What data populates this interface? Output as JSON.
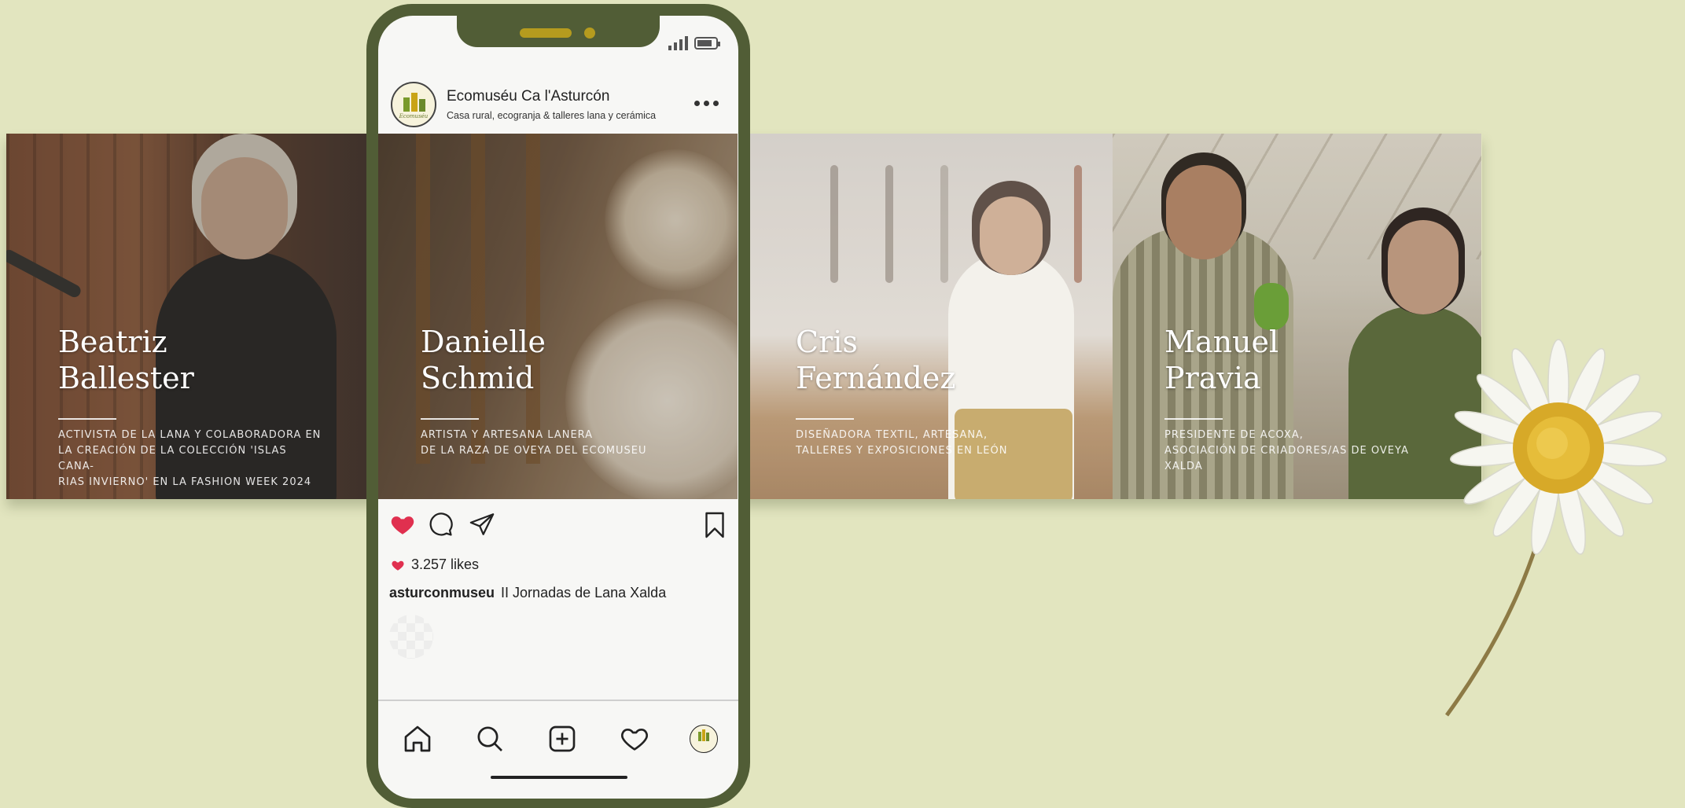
{
  "profile": {
    "name": "Ecomuséu Ca l'Asturcón",
    "subtitle": "Casa rural, ecogranja & talleres lana y cerámica",
    "logo_text": "Ecomuséu"
  },
  "post": {
    "likes": "3.257 likes",
    "caption_user": "asturconmuseu",
    "caption_text": "II Jornadas de Lana Xalda"
  },
  "panels": [
    {
      "name": "Beatriz\nBallester",
      "description": "ACTIVISTA DE LA LANA Y COLABORADORA EN\nLA CREACIÓN DE LA COLECCIÓN 'ISLAS CANA-\nRIAS INVIERNO' EN LA FASHION WEEK 2024"
    },
    {
      "name": "Danielle\nSchmid",
      "description": "ARTISTA Y ARTESANA LANERA\nDE LA RAZA DE OVEYA DEL ECOMUSEU"
    },
    {
      "name": "Cris\nFernández",
      "description": "DISEÑADORA TEXTIL, ARTESANA,\nTALLERES Y EXPOSICIONES EN LEÓN"
    },
    {
      "name": "Manuel\nPravia",
      "description": "PRESIDENTE DE ACOXA,\nASOCIACIÓN DE CRIADORES/AS DE OVEYA XALDA"
    }
  ],
  "colors": {
    "background": "#e2e5bf",
    "phone_frame": "#515d36",
    "like_red": "#e0304f",
    "accent_gold": "#b59b1e"
  },
  "icons": {
    "actions": [
      "heart-filled-icon",
      "comment-icon",
      "share-icon",
      "bookmark-icon"
    ],
    "tabs": [
      "home-icon",
      "search-icon",
      "add-post-icon",
      "activity-heart-icon",
      "profile-avatar-icon"
    ]
  }
}
